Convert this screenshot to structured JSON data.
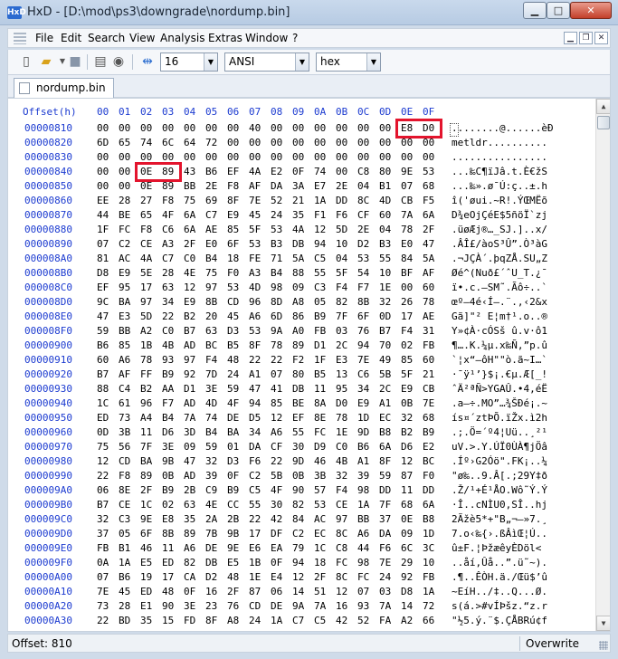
{
  "window": {
    "app_icon_text": "HxD",
    "title": "HxD - [D:\\mod\\ps3\\downgrade\\nordump.bin]",
    "min_glyph": "▁",
    "max_glyph": "□",
    "close_glyph": "✕"
  },
  "menu": [
    "File",
    "Edit",
    "Search",
    "View",
    "Analysis",
    "Extras",
    "Window",
    "?"
  ],
  "mdi_controls": {
    "minimize": "▁",
    "restore": "❐",
    "close": "✕"
  },
  "toolbar": {
    "bytes_per_row": "16",
    "charset": "ANSI",
    "offset_base": "hex",
    "icons": [
      "new-file-icon",
      "open-file-icon",
      "save-icon",
      "ram-icon",
      "disk-icon",
      "columns-icon"
    ]
  },
  "tab": {
    "label": "nordump.bin"
  },
  "editor": {
    "header": {
      "offset_label": "Offset(h)",
      "columns": [
        "00",
        "01",
        "02",
        "03",
        "04",
        "05",
        "06",
        "07",
        "08",
        "09",
        "0A",
        "0B",
        "0C",
        "0D",
        "0E",
        "0F"
      ]
    },
    "rows": [
      {
        "offset": "00000810",
        "bytes": [
          "00",
          "00",
          "00",
          "00",
          "00",
          "00",
          "00",
          "40",
          "00",
          "00",
          "00",
          "00",
          "00",
          "00",
          "E8",
          "D0"
        ],
        "ascii": "........@......èÐ"
      },
      {
        "offset": "00000820",
        "bytes": [
          "6D",
          "65",
          "74",
          "6C",
          "64",
          "72",
          "00",
          "00",
          "00",
          "00",
          "00",
          "00",
          "00",
          "00",
          "00",
          "00"
        ],
        "ascii": "metldr.........."
      },
      {
        "offset": "00000830",
        "bytes": [
          "00",
          "00",
          "00",
          "00",
          "00",
          "00",
          "00",
          "00",
          "00",
          "00",
          "00",
          "00",
          "00",
          "00",
          "00",
          "00"
        ],
        "ascii": "................"
      },
      {
        "offset": "00000840",
        "bytes": [
          "00",
          "00",
          "0E",
          "89",
          "43",
          "B6",
          "EF",
          "4A",
          "E2",
          "0F",
          "74",
          "00",
          "C8",
          "80",
          "9E",
          "53"
        ],
        "ascii": "...‰C¶ïJâ.t.È€žS"
      },
      {
        "offset": "00000850",
        "bytes": [
          "00",
          "00",
          "0E",
          "89",
          "BB",
          "2E",
          "F8",
          "AF",
          "DA",
          "3A",
          "E7",
          "2E",
          "04",
          "B1",
          "07",
          "68"
        ],
        "ascii": "...‰».ø¯Ú:ç..±.h"
      },
      {
        "offset": "00000860",
        "bytes": [
          "EE",
          "28",
          "27",
          "F8",
          "75",
          "69",
          "8F",
          "7E",
          "52",
          "21",
          "1A",
          "DD",
          "8C",
          "4D",
          "CB",
          "F5"
        ],
        "ascii": "î('øui.~R!.ÝŒMËõ"
      },
      {
        "offset": "00000870",
        "bytes": [
          "44",
          "BE",
          "65",
          "4F",
          "6A",
          "C7",
          "E9",
          "45",
          "24",
          "35",
          "F1",
          "F6",
          "CF",
          "60",
          "7A",
          "6A"
        ],
        "ascii": "D¾eOjÇéE$5ñöÏ`zj"
      },
      {
        "offset": "00000880",
        "bytes": [
          "1F",
          "FC",
          "F8",
          "C6",
          "6A",
          "AE",
          "85",
          "5F",
          "53",
          "4A",
          "12",
          "5D",
          "2E",
          "04",
          "78",
          "2F"
        ],
        "ascii": ".üøÆj®…_SJ.]..x/"
      },
      {
        "offset": "00000890",
        "bytes": [
          "07",
          "C2",
          "CE",
          "A3",
          "2F",
          "E0",
          "6F",
          "53",
          "B3",
          "DB",
          "94",
          "10",
          "D2",
          "B3",
          "E0",
          "47"
        ],
        "ascii": ".ÂÎ£/àoS³Û”.Ò³àG"
      },
      {
        "offset": "000008A0",
        "bytes": [
          "81",
          "AC",
          "4A",
          "C7",
          "C0",
          "B4",
          "18",
          "FE",
          "71",
          "5A",
          "C5",
          "04",
          "53",
          "55",
          "84",
          "5A"
        ],
        "ascii": ".¬JÇÀ´.þqZÅ.SU„Z"
      },
      {
        "offset": "000008B0",
        "bytes": [
          "D8",
          "E9",
          "5E",
          "28",
          "4E",
          "75",
          "F0",
          "A3",
          "B4",
          "88",
          "55",
          "5F",
          "54",
          "10",
          "BF",
          "AF"
        ],
        "ascii": "Øé^(Nuð£´ˆU_T.¿¯"
      },
      {
        "offset": "000008C0",
        "bytes": [
          "EF",
          "95",
          "17",
          "63",
          "12",
          "97",
          "53",
          "4D",
          "98",
          "09",
          "C3",
          "F4",
          "F7",
          "1E",
          "00",
          "60"
        ],
        "ascii": "ï•.c.—SM˜.Ãô÷..`"
      },
      {
        "offset": "000008D0",
        "bytes": [
          "9C",
          "BA",
          "97",
          "34",
          "E9",
          "8B",
          "CD",
          "96",
          "8D",
          "A8",
          "05",
          "82",
          "8B",
          "32",
          "26",
          "78"
        ],
        "ascii": "œº—4é‹Í–.¨.‚‹2&x"
      },
      {
        "offset": "000008E0",
        "bytes": [
          "47",
          "E3",
          "5D",
          "22",
          "B2",
          "20",
          "45",
          "A6",
          "6D",
          "86",
          "B9",
          "7F",
          "6F",
          "0D",
          "17",
          "AE"
        ],
        "ascii": "Gã]\"² E¦m†¹.o..®"
      },
      {
        "offset": "000008F0",
        "bytes": [
          "59",
          "BB",
          "A2",
          "C0",
          "B7",
          "63",
          "D3",
          "53",
          "9A",
          "A0",
          "FB",
          "03",
          "76",
          "B7",
          "F4",
          "31"
        ],
        "ascii": "Y»¢À·cÓSš û.v·ô1"
      },
      {
        "offset": "00000900",
        "bytes": [
          "B6",
          "85",
          "1B",
          "4B",
          "AD",
          "BC",
          "B5",
          "8F",
          "78",
          "89",
          "D1",
          "2C",
          "94",
          "70",
          "02",
          "FB"
        ],
        "ascii": "¶….K.¼µ.x‰Ñ,”p.û"
      },
      {
        "offset": "00000910",
        "bytes": [
          "60",
          "A6",
          "78",
          "93",
          "97",
          "F4",
          "48",
          "22",
          "22",
          "F2",
          "1F",
          "E3",
          "7E",
          "49",
          "85",
          "60"
        ],
        "ascii": "`¦x“—ôH\"\"ò.ã~I…`"
      },
      {
        "offset": "00000920",
        "bytes": [
          "B7",
          "AF",
          "FF",
          "B9",
          "92",
          "7D",
          "24",
          "A1",
          "07",
          "80",
          "B5",
          "13",
          "C6",
          "5B",
          "5F",
          "21"
        ],
        "ascii": "·¯ÿ¹’}$¡.€µ.Æ[_!"
      },
      {
        "offset": "00000930",
        "bytes": [
          "88",
          "C4",
          "B2",
          "AA",
          "D1",
          "3E",
          "59",
          "47",
          "41",
          "DB",
          "11",
          "95",
          "34",
          "2C",
          "E9",
          "CB"
        ],
        "ascii": "ˆÄ²ªÑ>YGAÛ.•4,éË"
      },
      {
        "offset": "00000940",
        "bytes": [
          "1C",
          "61",
          "96",
          "F7",
          "AD",
          "4D",
          "4F",
          "94",
          "85",
          "BE",
          "8A",
          "D0",
          "E9",
          "A1",
          "0B",
          "7E"
        ],
        "ascii": ".a–÷.MO”…¾ŠÐé¡.~"
      },
      {
        "offset": "00000950",
        "bytes": [
          "ED",
          "73",
          "A4",
          "B4",
          "7A",
          "74",
          "DE",
          "D5",
          "12",
          "EF",
          "8E",
          "78",
          "1D",
          "EC",
          "32",
          "68"
        ],
        "ascii": "ís¤´ztÞÕ.ïŽx.ì2h"
      },
      {
        "offset": "00000960",
        "bytes": [
          "0D",
          "3B",
          "11",
          "D6",
          "3D",
          "B4",
          "BA",
          "34",
          "A6",
          "55",
          "FC",
          "1E",
          "9D",
          "B8",
          "B2",
          "B9"
        ],
        "ascii": ".;.Ö=´º4¦Uü..¸²¹"
      },
      {
        "offset": "00000970",
        "bytes": [
          "75",
          "56",
          "7F",
          "3E",
          "09",
          "59",
          "01",
          "DA",
          "CF",
          "30",
          "D9",
          "C0",
          "B6",
          "6A",
          "D6",
          "E2"
        ],
        "ascii": "uV.>.Y.ÚÏ0ÙÀ¶jÖâ"
      },
      {
        "offset": "00000980",
        "bytes": [
          "12",
          "CD",
          "BA",
          "9B",
          "47",
          "32",
          "D3",
          "F6",
          "22",
          "9D",
          "46",
          "4B",
          "A1",
          "8F",
          "12",
          "BC"
        ],
        "ascii": ".Íº›G2Óö\".FK¡..¼"
      },
      {
        "offset": "00000990",
        "bytes": [
          "22",
          "F8",
          "89",
          "0B",
          "AD",
          "39",
          "0F",
          "C2",
          "5B",
          "0B",
          "3B",
          "32",
          "39",
          "59",
          "87",
          "F0"
        ],
        "ascii": "\"ø‰..9.Â[.;29Y‡ð"
      },
      {
        "offset": "000009A0",
        "bytes": [
          "06",
          "8E",
          "2F",
          "B9",
          "2B",
          "C9",
          "B9",
          "C5",
          "4F",
          "90",
          "57",
          "F4",
          "98",
          "DD",
          "11",
          "DD"
        ],
        "ascii": ".Ž/¹+É¹ÅO.Wô˜Ý.Ý"
      },
      {
        "offset": "000009B0",
        "bytes": [
          "B7",
          "CE",
          "1C",
          "02",
          "63",
          "4E",
          "CC",
          "55",
          "30",
          "82",
          "53",
          "CE",
          "1A",
          "7F",
          "68",
          "6A"
        ],
        "ascii": "·Î..cNÌU0‚SÎ..hj"
      },
      {
        "offset": "000009C0",
        "bytes": [
          "32",
          "C3",
          "9E",
          "E8",
          "35",
          "2A",
          "2B",
          "22",
          "42",
          "84",
          "AC",
          "97",
          "BB",
          "37",
          "0E",
          "B8"
        ],
        "ascii": "2Ãžè5*+\"B„¬—»7.¸"
      },
      {
        "offset": "000009D0",
        "bytes": [
          "37",
          "05",
          "6F",
          "8B",
          "89",
          "7B",
          "9B",
          "17",
          "DF",
          "C2",
          "EC",
          "8C",
          "A6",
          "DA",
          "09",
          "1D"
        ],
        "ascii": "7.o‹‰{›.ßÂìŒ¦Ú.."
      },
      {
        "offset": "000009E0",
        "bytes": [
          "FB",
          "B1",
          "46",
          "11",
          "A6",
          "DE",
          "9E",
          "E6",
          "EA",
          "79",
          "1C",
          "C8",
          "44",
          "F6",
          "6C",
          "3C"
        ],
        "ascii": "û±F.¦ÞžæêyÈDöl<"
      },
      {
        "offset": "000009F0",
        "bytes": [
          "0A",
          "1A",
          "E5",
          "ED",
          "82",
          "DB",
          "E5",
          "1B",
          "0F",
          "94",
          "18",
          "FC",
          "98",
          "7E",
          "29",
          "10"
        ],
        "ascii": "..åí‚Ûå..”.ü˜~)."
      },
      {
        "offset": "00000A00",
        "bytes": [
          "07",
          "B6",
          "19",
          "17",
          "CA",
          "D2",
          "48",
          "1E",
          "E4",
          "12",
          "2F",
          "8C",
          "FC",
          "24",
          "92",
          "FB"
        ],
        "ascii": ".¶..ÊÒH.ä./Œü$’û"
      },
      {
        "offset": "00000A10",
        "bytes": [
          "7E",
          "45",
          "ED",
          "48",
          "0F",
          "16",
          "2F",
          "87",
          "06",
          "14",
          "51",
          "12",
          "07",
          "03",
          "D8",
          "1A"
        ],
        "ascii": "~EíH../‡..Q...Ø."
      },
      {
        "offset": "00000A20",
        "bytes": [
          "73",
          "28",
          "E1",
          "90",
          "3E",
          "23",
          "76",
          "CD",
          "DE",
          "9A",
          "7A",
          "16",
          "93",
          "7A",
          "14",
          "72"
        ],
        "ascii": "s(á.>#vÍÞšz.“z.r"
      },
      {
        "offset": "00000A30",
        "bytes": [
          "22",
          "BD",
          "35",
          "15",
          "FD",
          "8F",
          "A8",
          "24",
          "1A",
          "C7",
          "C5",
          "42",
          "52",
          "FA",
          "A2",
          "66"
        ],
        "ascii": "\"½5.ý.¨$.ÇÅBRú¢f"
      }
    ]
  },
  "status": {
    "offset": "Offset: 810",
    "mode": "Overwrite"
  },
  "colors": {
    "offset_blue": "#1c3bd0",
    "highlight_red": "#e3142d"
  }
}
